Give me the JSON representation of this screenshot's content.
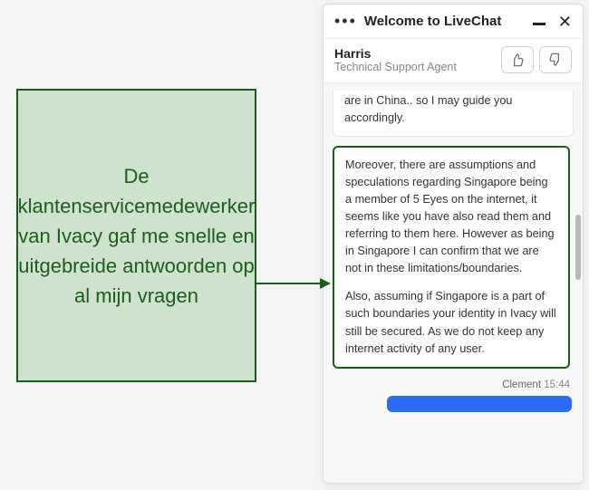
{
  "annotation": {
    "text": "De klantenservicemedewerker van Ivacy gaf me snelle en uitgebreide antwoorden op al mijn vragen"
  },
  "chat": {
    "header_title": "Welcome to LiveChat",
    "agent": {
      "name": "Harris",
      "role": "Technical Support Agent"
    },
    "messages": {
      "m1_partial": "are in China.. so I may guide you accordingly.",
      "m2_p1": "Moreover, there are assumptions and speculations regarding Singapore being a member of 5 Eyes on the internet, it seems like you have also read them and referring to them here. However as being in Singapore I can confirm that we are not in these limitations/boundaries.",
      "m2_p2": "Also, assuming if Singapore is a part of such boundaries your identity in Ivacy will still be secured. As we do not keep any internet activity of any user."
    },
    "user": {
      "name": "Clement",
      "time": "15:44"
    }
  }
}
